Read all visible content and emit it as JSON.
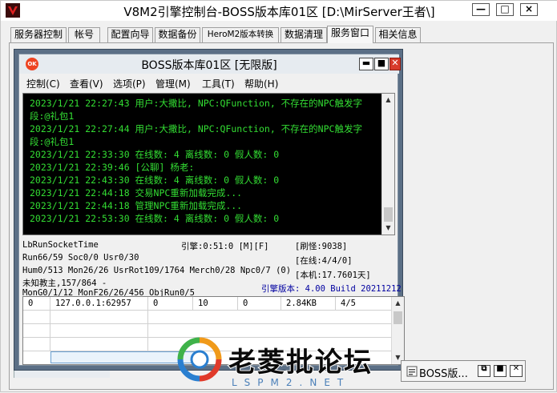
{
  "window": {
    "title": "V8M2引擎控制台-BOSS版本库01区 [D:\\MirServer王者\\]",
    "minimize_glyph": "—",
    "maximize_glyph": "□",
    "close_glyph": "×"
  },
  "tabs": [
    {
      "label": "服务器控制"
    },
    {
      "label": "帐号"
    },
    {
      "label": "配置向导"
    },
    {
      "label": "数据备份"
    },
    {
      "label": "HeroM2版本转换"
    },
    {
      "label": "数据清理"
    },
    {
      "label": "服务窗口"
    },
    {
      "label": "相关信息"
    }
  ],
  "active_tab": "服务窗口",
  "inner_window": {
    "icon_text": "OK",
    "title": "BOSS版本库01区 [无限版]",
    "minimize_glyph": "▬",
    "maximize_glyph": "■",
    "close_glyph": "✕"
  },
  "menu": [
    {
      "label": "控制(C)"
    },
    {
      "label": "查看(V)"
    },
    {
      "label": "选项(P)"
    },
    {
      "label": "管理(M)"
    },
    {
      "label": "工具(T)"
    },
    {
      "label": "帮助(H)"
    }
  ],
  "log_lines": [
    "2023/1/21 22:27:43 用户:大撒比, NPC:QFunction, 不存在的NPC触发字",
    "段:@礼包1",
    "2023/1/21 22:27:44 用户:大撒比, NPC:QFunction, 不存在的NPC触发字",
    "段:@礼包1",
    "2023/1/21 22:33:30 在线数: 4 离线数: 0 假人数: 0",
    "2023/1/21 22:39:46 [公聊] 杨老:",
    "2023/1/21 22:43:30 在线数: 4 离线数: 0 假人数: 0",
    "2023/1/21 22:44:18 交易NPC重新加载完成...",
    "2023/1/21 22:44:18 管理NPC重新加载完成...",
    "2023/1/21 22:53:30 在线数: 4 离线数: 0 假人数: 0"
  ],
  "status": {
    "socket": "LbRunSocketTime",
    "engine": "引擎:0:51:0 [M][F]",
    "refresh": "[刷怪:9038]",
    "run": "Run66/59 Soc0/0 Usr0/30",
    "online": "[在线:4/4/0]",
    "hum": "Hum0/513 Mon26/26 UsrRot109/1764 Merch0/28 Npc0/7 (0)",
    "unknown": "未知教主,157/864 -",
    "local": "[本机:17.7601天]",
    "mon": "MonG0/1/12 MonF26/26/456 ObjRun0/5",
    "version": "引擎版本: 4.00 Build 20211212"
  },
  "grid": {
    "rows": [
      {
        "c0": "0",
        "c1": "127.0.0.1:62957",
        "c2": "0",
        "c3": "10",
        "c4": "0",
        "c5": "2.84KB",
        "c6": "4/5"
      }
    ]
  },
  "minimized_window": {
    "title": "BOSS版...",
    "restore_glyph": "⧉",
    "maximize_glyph": "■",
    "close_glyph": "✕"
  },
  "watermark": {
    "text": "老菱批论坛",
    "sub": "LSPM2.NET"
  },
  "colors": {
    "console_bg": "#000000",
    "console_text": "#33dd33",
    "version_text": "#0000a0",
    "inner_frame": "#5b6f86"
  }
}
